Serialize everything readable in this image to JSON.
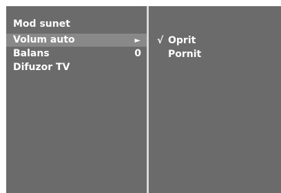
{
  "menu": {
    "items": [
      {
        "label": "Mod sunet",
        "value": ""
      },
      {
        "label": "Volum auto",
        "value": "",
        "arrow": "►",
        "selected": true
      },
      {
        "label": "Balans",
        "value": "0"
      },
      {
        "label": "Difuzor TV",
        "value": ""
      }
    ]
  },
  "submenu": {
    "options": [
      {
        "label": "Oprit",
        "check": "√"
      },
      {
        "label": "Pornit",
        "check": ""
      }
    ]
  },
  "colors": {
    "background": "#6b6b6b",
    "selected_row": "#898989",
    "divider": "#d8d8d8",
    "text": "#ffffff"
  }
}
